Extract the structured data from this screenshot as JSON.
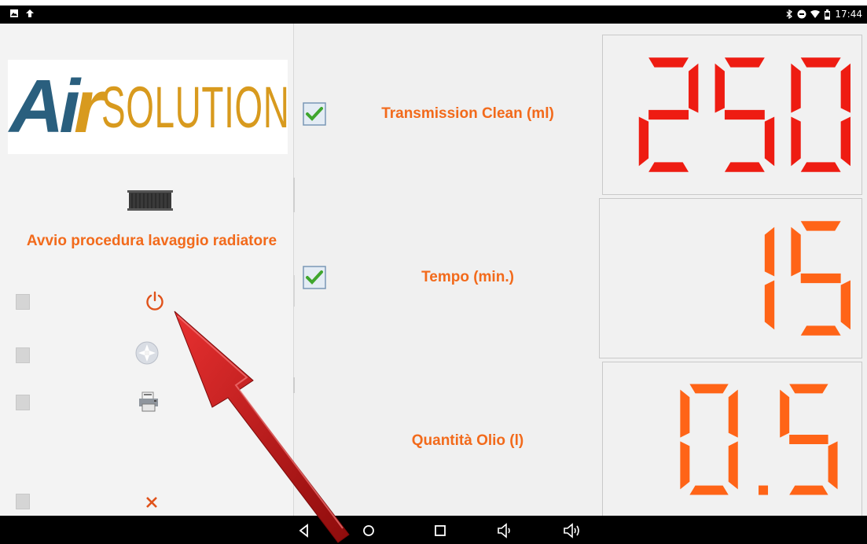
{
  "status_bar": {
    "time": "17:44",
    "left_icons": [
      "gallery-icon",
      "upload-icon"
    ],
    "right_icons": [
      "bluetooth-icon",
      "do-not-disturb-icon",
      "wifi-icon",
      "battery-icon"
    ]
  },
  "left_panel": {
    "logo_text_a": "Ai",
    "logo_text_b": "r",
    "logo_text_c": "SOLUTIONS",
    "title": "Avvio procedura lavaggio radiatore",
    "buttons": [
      {
        "icon": "power-icon",
        "checked": false,
        "color": "#e0521a"
      },
      {
        "icon": "fan-icon",
        "checked": false
      },
      {
        "icon": "printer-icon",
        "checked": false
      },
      {
        "icon": "close-icon",
        "checked": false,
        "color": "#e0521a"
      }
    ]
  },
  "rows": [
    {
      "label": "Transmission Clean (ml)",
      "checked": true,
      "value": "250",
      "color": "#ee1c12"
    },
    {
      "label": "Tempo (min.)",
      "checked": true,
      "value": "15",
      "color": "#ff6417"
    },
    {
      "label": "Quantità Olio (l)",
      "checked": false,
      "value": "0.5",
      "color": "#ff6417"
    }
  ],
  "colors": {
    "accent": "#f26a1b",
    "check_green": "#3fa62e",
    "logo_blue": "#2a5f7e",
    "logo_gold": "#d89a1e"
  },
  "nav_bar": {
    "icons": [
      "back-icon",
      "home-icon",
      "recents-icon",
      "volume-down-icon",
      "volume-up-icon"
    ]
  },
  "annotation": {
    "icon": "red-arrow",
    "color": "#c81414"
  }
}
